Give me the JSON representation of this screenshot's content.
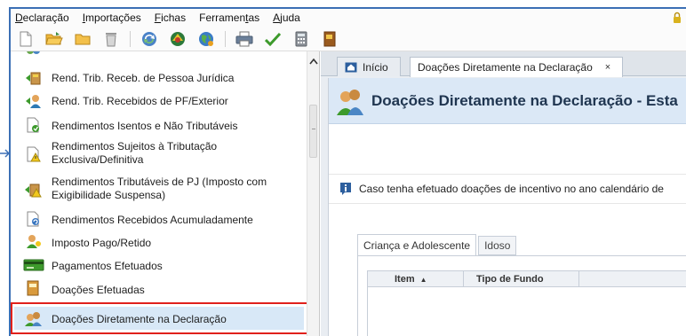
{
  "menu": {
    "items": [
      {
        "label": "Declaração",
        "underline_index": 0
      },
      {
        "label": "Importações",
        "underline_index": 0
      },
      {
        "label": "Fichas",
        "underline_index": 0
      },
      {
        "label": "Ferramentas",
        "underline_index": 8
      },
      {
        "label": "Ajuda",
        "underline_index": 0
      }
    ]
  },
  "toolbar": {
    "icons": [
      "new-file-icon",
      "open-folder-icon",
      "folder-icon",
      "trash-icon",
      "sync-icon",
      "receita-icon",
      "globe-icon",
      "print-icon",
      "check-icon",
      "calculator-icon",
      "book-icon"
    ]
  },
  "sidebar": {
    "items": [
      {
        "label": "Rend. Trib. Receb. de Pessoa Jurídica",
        "icon": "pj-income-icon"
      },
      {
        "label": "Rend. Trib. Recebidos de PF/Exterior",
        "icon": "pf-income-icon"
      },
      {
        "label": "Rendimentos Isentos e Não Tributáveis",
        "icon": "exempt-income-icon"
      },
      {
        "label": "Rendimentos Sujeitos à Tributação",
        "label2": "Exclusiva/Definitiva",
        "icon": "exclusive-tax-icon"
      },
      {
        "label": "Rendimentos Tributáveis de PJ (Imposto com",
        "label2": "Exigibilidade Suspensa)",
        "icon": "suspended-tax-icon"
      },
      {
        "label": "Rendimentos Recebidos Acumuladamente",
        "icon": "accumulated-income-icon"
      },
      {
        "label": "Imposto Pago/Retido",
        "icon": "tax-paid-icon"
      },
      {
        "label": "Pagamentos Efetuados",
        "icon": "payments-icon"
      },
      {
        "label": "Doações Efetuadas",
        "icon": "donations-icon"
      },
      {
        "label": "Doações Diretamente na Declaração",
        "icon": "direct-donations-icon"
      }
    ]
  },
  "tabs": {
    "home": "Início",
    "active": "Doações Diretamente na Declaração",
    "close": "×"
  },
  "page": {
    "title": "Doações Diretamente na Declaração - Esta",
    "info": "Caso tenha efetuado doações de incentivo no ano calendário de"
  },
  "subtabs": [
    "Criança e Adolescente",
    "Idoso"
  ],
  "table": {
    "columns": [
      "Item",
      "Tipo de Fundo"
    ],
    "sort_indicator": "▲"
  },
  "colors": {
    "accent": "#3b6fb5",
    "selection_border": "#e0201b",
    "header_bg": "#dbe8f6"
  }
}
